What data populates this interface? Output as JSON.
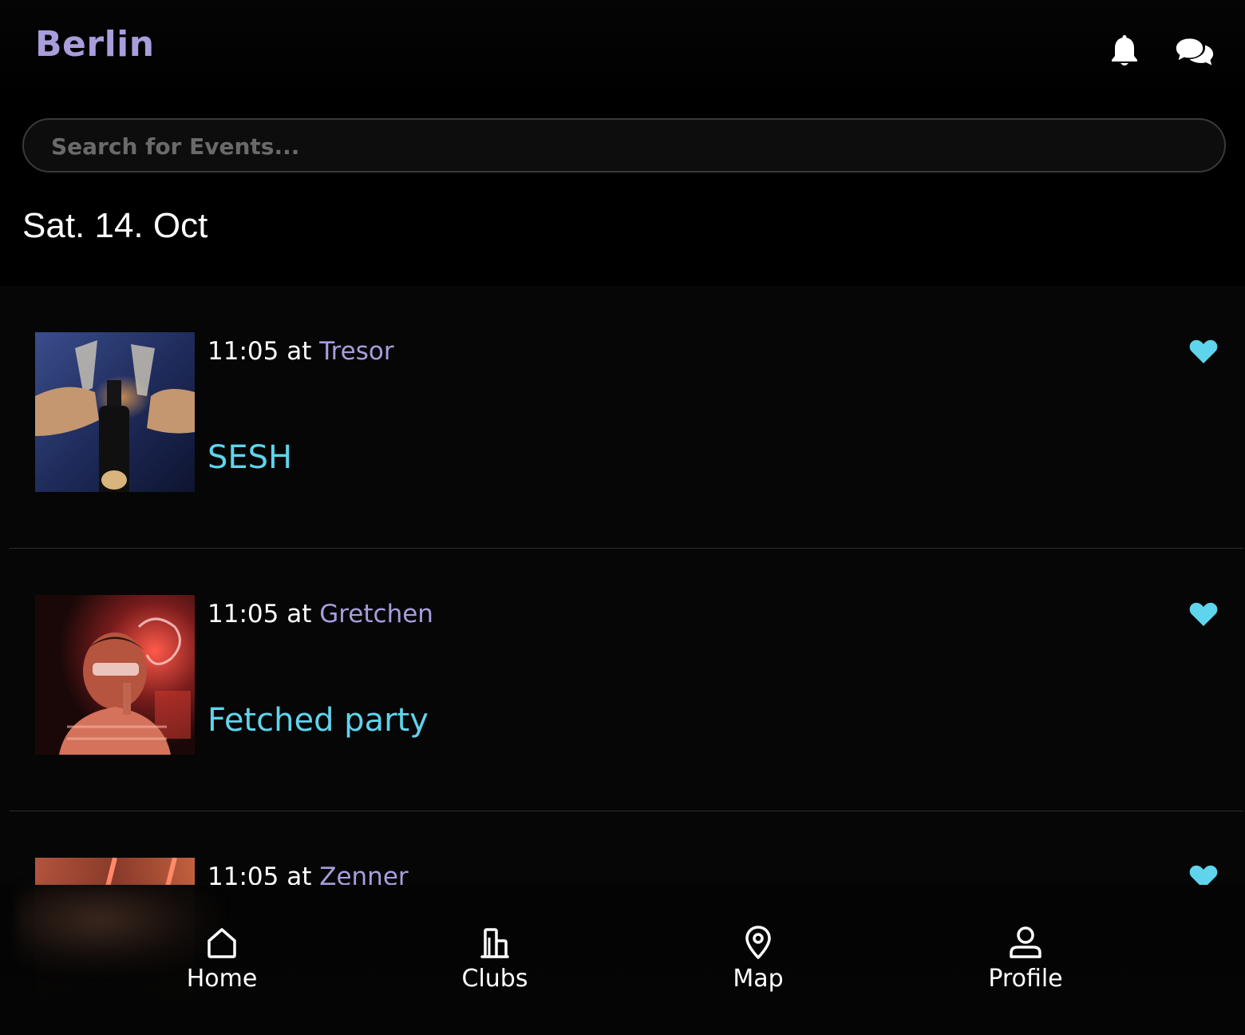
{
  "header": {
    "city": "Berlin",
    "icons": [
      "bell-icon",
      "chat-bubbles-icon"
    ]
  },
  "search": {
    "placeholder": "Search for Events...",
    "value": ""
  },
  "date_heading": "Sat. 14. Oct",
  "colors": {
    "accent_purple": "#a99ddc",
    "accent_cyan": "#5fd4ec",
    "background": "#000000"
  },
  "events": [
    {
      "time": "11:05",
      "at": "at",
      "club": "Tresor",
      "title": "SESH",
      "favorited": true
    },
    {
      "time": "11:05",
      "at": "at",
      "club": "Gretchen",
      "title": "Fetched party",
      "favorited": true
    },
    {
      "time": "11:05",
      "at": "at",
      "club": "Zenner",
      "title": "",
      "favorited": true
    }
  ],
  "nav": {
    "items": [
      {
        "label": "Home",
        "icon": "home-icon"
      },
      {
        "label": "Clubs",
        "icon": "building-icon"
      },
      {
        "label": "Map",
        "icon": "map-pin-icon"
      },
      {
        "label": "Profile",
        "icon": "user-icon"
      }
    ]
  }
}
